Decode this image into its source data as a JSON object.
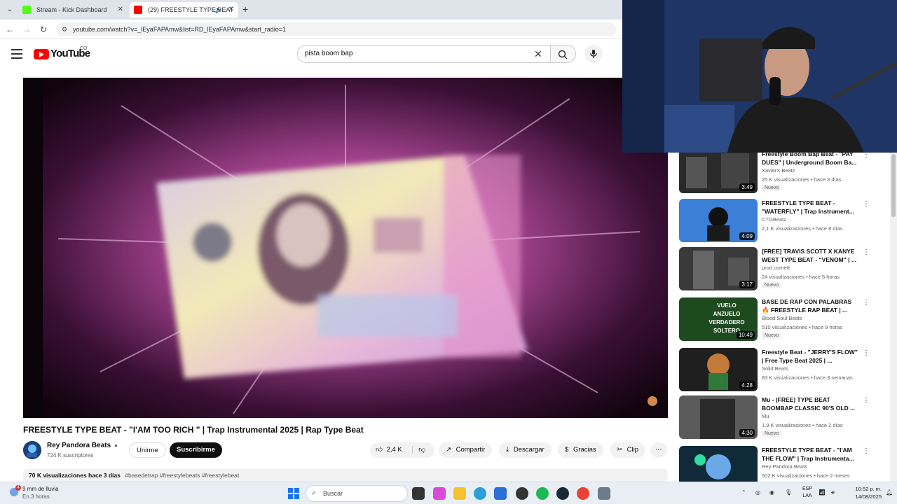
{
  "browser": {
    "tabs": [
      {
        "title": "Stream - Kick Dashboard",
        "favicon_color": "#53fc18"
      },
      {
        "title": "(29) FREESTYLE TYPE BEAT",
        "favicon_color": "#ff0000"
      }
    ],
    "url": "youtube.com/watch?v=_lEyaFAPAmw&list=RD_lEyaFAPAmw&start_radio=1"
  },
  "youtube": {
    "brand": "YouTube",
    "country_code": "CO",
    "search_value": "pista boom bap"
  },
  "video": {
    "title": "FREESTYLE TYPE BEAT - \"I'AM TOO RICH \" | Trap Instrumental 2025 | Rap Type Beat",
    "channel": "Rey Pandora Beats",
    "subscribers": "724 K suscriptores",
    "join_label": "Unirme",
    "subscribe_label": "Suscribirme",
    "likes": "2,4 K",
    "share_label": "Compartir",
    "download_label": "Descargar",
    "thanks_label": "Gracias",
    "clip_label": "Clip",
    "more_label": "⋯",
    "views_date": "70 K visualizaciones  hace 3 días",
    "hashtags": "#basedetrap #freestylebeats #freestylebeat"
  },
  "recommendations": [
    {
      "title": "Freestyle Boom Bap Beat - \"PAY DUES\" | Underground Boom Ba...",
      "channel": "XavierX Beatz",
      "meta": "25 K visualizaciones • hace 3 días",
      "duration": "3:49",
      "badge": "Nuevo",
      "thumb_color": "#3a3a3a"
    },
    {
      "title": "FREESTYLE TYPE BEAT - \"WATERFLY\" | Trap Instrument...",
      "channel": "CTGBeatz",
      "meta": "2,1 K visualizaciones • hace 8 días",
      "duration": "4:09",
      "badge": "",
      "thumb_color": "#3b7fd9"
    },
    {
      "title": "[FREE] TRAVIS SCOTT X KANYE WEST TYPE BEAT - \"VENOM\" | ...",
      "channel": "prod.cornett",
      "meta": "24 visualizaciones • hace 5 horas",
      "duration": "3:17",
      "badge": "Nuevo",
      "thumb_color": "#4a4a4a"
    },
    {
      "title": "BASE DE RAP CON PALABRAS 🔥 FREESTYLE RAP BEAT | ...",
      "channel": "Blood Soul Beats",
      "meta": "510 visualizaciones • hace 9 horas",
      "duration": "10:49",
      "badge": "Nuevo",
      "thumb_color": "#1d4a1f",
      "thumb_text": "VUELO ANZUELO VERDADERO SOLTERO"
    },
    {
      "title": "Freestyle Beat - \"JERRY'S FLOW\" | Free Type Beat 2025 | ...",
      "channel": "Solid Beats",
      "meta": "83 K visualizaciones • hace 3 semanas",
      "duration": "4:28",
      "badge": "",
      "thumb_color": "#2b2b2b"
    },
    {
      "title": "Mu - (FREE) TYPE BEAT BOOMBAP CLASSIC 90'S OLD ...",
      "channel": "Mu",
      "meta": "1,9 K visualizaciones • hace 2 días",
      "duration": "4:30",
      "badge": "Nuevo",
      "thumb_color": "#5a5a5a"
    },
    {
      "title": "FREESTYLE TYPE BEAT - \"I'AM THE FLOW\" | Trap Instrumenta...",
      "channel": "Rey Pandora Beats",
      "meta": "502 K visualizaciones • hace 2 meses",
      "duration": "",
      "badge": "",
      "thumb_color": "#1f3a4a"
    }
  ],
  "taskbar": {
    "weather_line1": "9 mm de lluvia",
    "weather_line2": "En 3 horas",
    "weather_badge": "4",
    "search_label": "Buscar",
    "lang": "ESP",
    "lang2": "LAA",
    "time": "10:52 p. m.",
    "date": "14/08/2025"
  }
}
